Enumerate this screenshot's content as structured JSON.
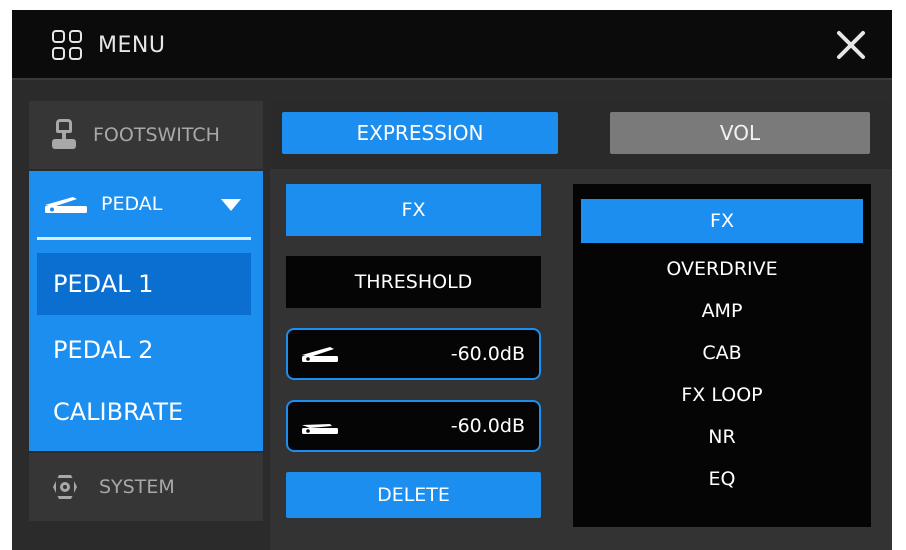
{
  "header": {
    "menu_label": "MENU"
  },
  "sidebar": {
    "footswitch_label": "FOOTSWITCH",
    "pedal_label": "PEDAL",
    "sub_items": [
      "PEDAL 1",
      "PEDAL 2",
      "CALIBRATE"
    ],
    "system_label": "SYSTEM"
  },
  "tabs": {
    "expression": "EXPRESSION",
    "vol": "VOL"
  },
  "controls": {
    "fx_button": "FX",
    "threshold_label": "THRESHOLD",
    "value_heel": "-60.0dB",
    "value_toe": "-60.0dB",
    "delete_label": "DELETE"
  },
  "fx_list": {
    "selected": "FX",
    "items": [
      "FX",
      "OVERDRIVE",
      "AMP",
      "CAB",
      "FX LOOP",
      "NR",
      "EQ"
    ]
  },
  "colors": {
    "accent": "#1b8ef0",
    "accent_dark": "#0b6fd1",
    "panel": "#333333"
  },
  "icons": {
    "menu": "grid-icon",
    "close": "close-icon",
    "footswitch": "footswitch-icon",
    "pedal": "pedal-icon",
    "system": "gear-icon"
  }
}
